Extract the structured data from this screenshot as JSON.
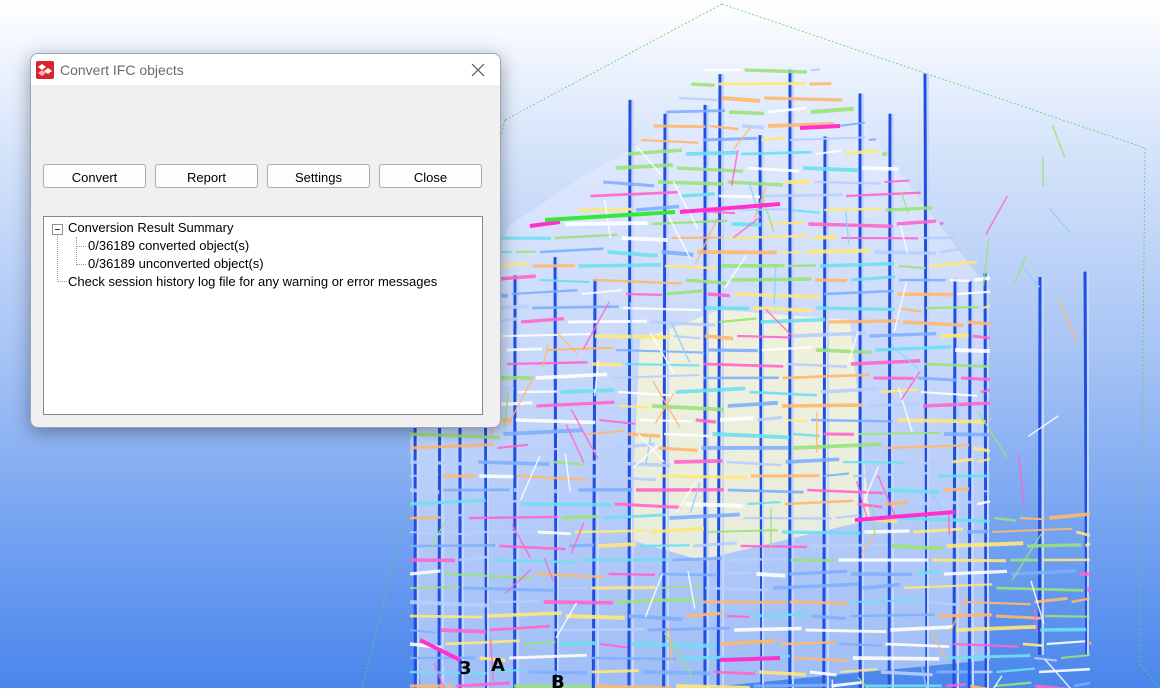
{
  "viewport": {
    "grid_labels": [
      "3",
      "A",
      "B"
    ]
  },
  "dialog": {
    "title": "Convert IFC objects",
    "buttons": {
      "convert": "Convert",
      "report": "Report",
      "settings": "Settings",
      "close": "Close"
    },
    "tree": {
      "root": "Conversion Result Summary",
      "children": [
        "0/36189 converted object(s)",
        "0/36189 unconverted object(s)"
      ],
      "note": "Check session history log file for any warning or error messages"
    }
  }
}
